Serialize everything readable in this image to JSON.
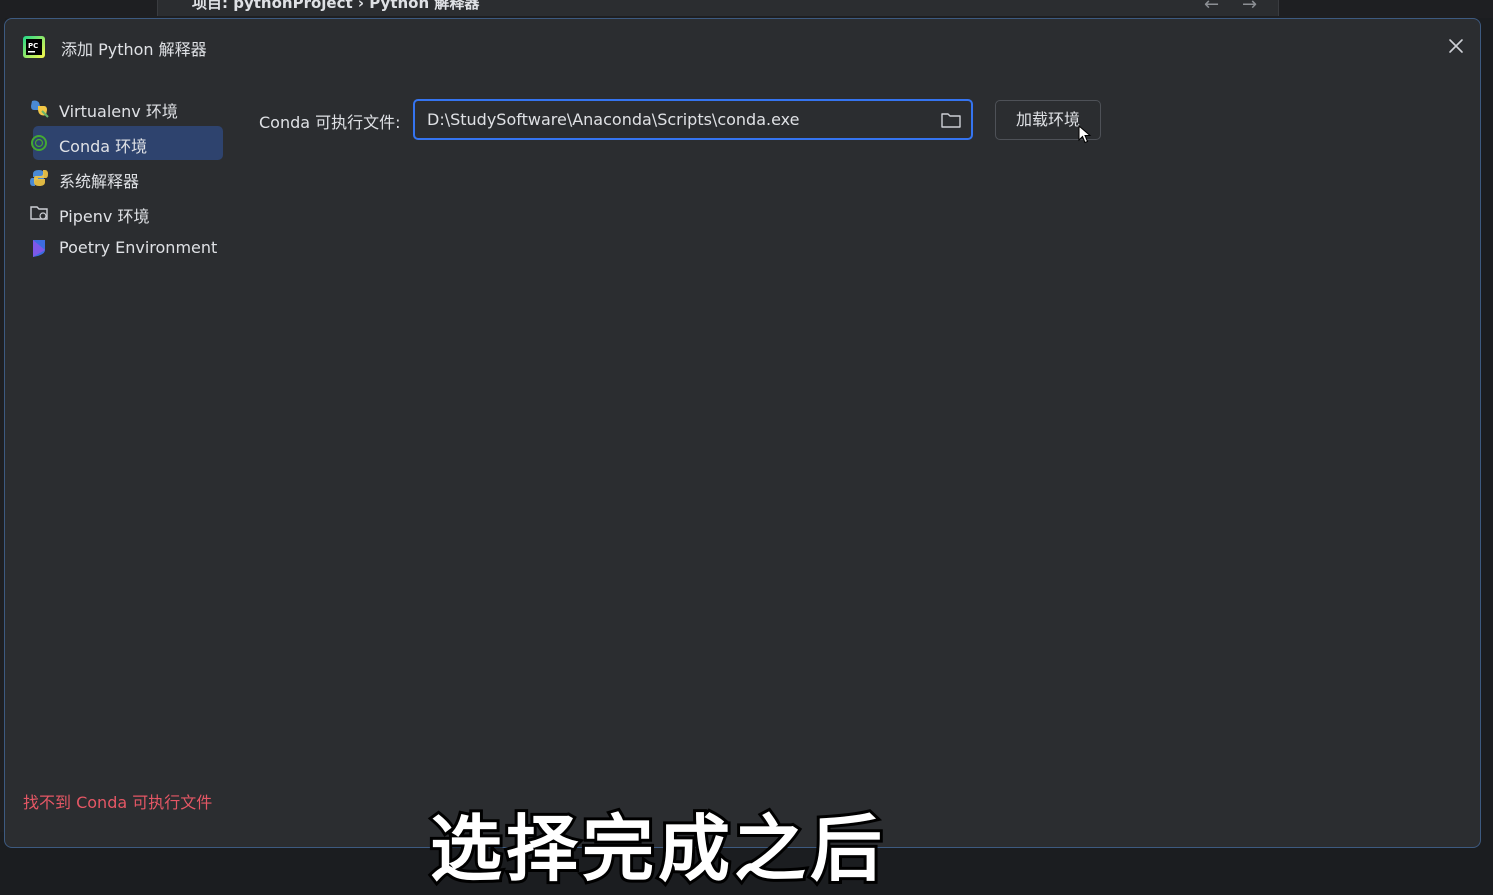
{
  "background": {
    "breadcrumb": "项目: pythonProject  ›  Python 解释器"
  },
  "dialog": {
    "title": "添加 Python 解释器",
    "close_icon": "close-icon",
    "app_icon": "pycharm-icon"
  },
  "sidebar": {
    "items": [
      {
        "label": "Virtualenv 环境",
        "icon": "virtualenv-icon",
        "selected": false
      },
      {
        "label": "Conda 环境",
        "icon": "conda-icon",
        "selected": true
      },
      {
        "label": "系统解释器",
        "icon": "python-icon",
        "selected": false
      },
      {
        "label": "Pipenv 环境",
        "icon": "pipenv-icon",
        "selected": false
      },
      {
        "label": "Poetry Environment",
        "icon": "poetry-icon",
        "selected": false
      }
    ]
  },
  "form": {
    "conda_label": "Conda 可执行文件:",
    "conda_path": "D:\\StudySoftware\\Anaconda\\Scripts\\conda.exe",
    "browse_icon": "folder-icon",
    "load_button": "加载环境"
  },
  "status": {
    "error": "找不到 Conda 可执行文件"
  },
  "overlay": {
    "subtitle": "选择完成之后"
  },
  "colors": {
    "dialog_bg": "#2b2d30",
    "accent": "#3574f0",
    "selected_bg": "#2e436e",
    "error": "#e55765",
    "text": "#dfe1e5"
  }
}
